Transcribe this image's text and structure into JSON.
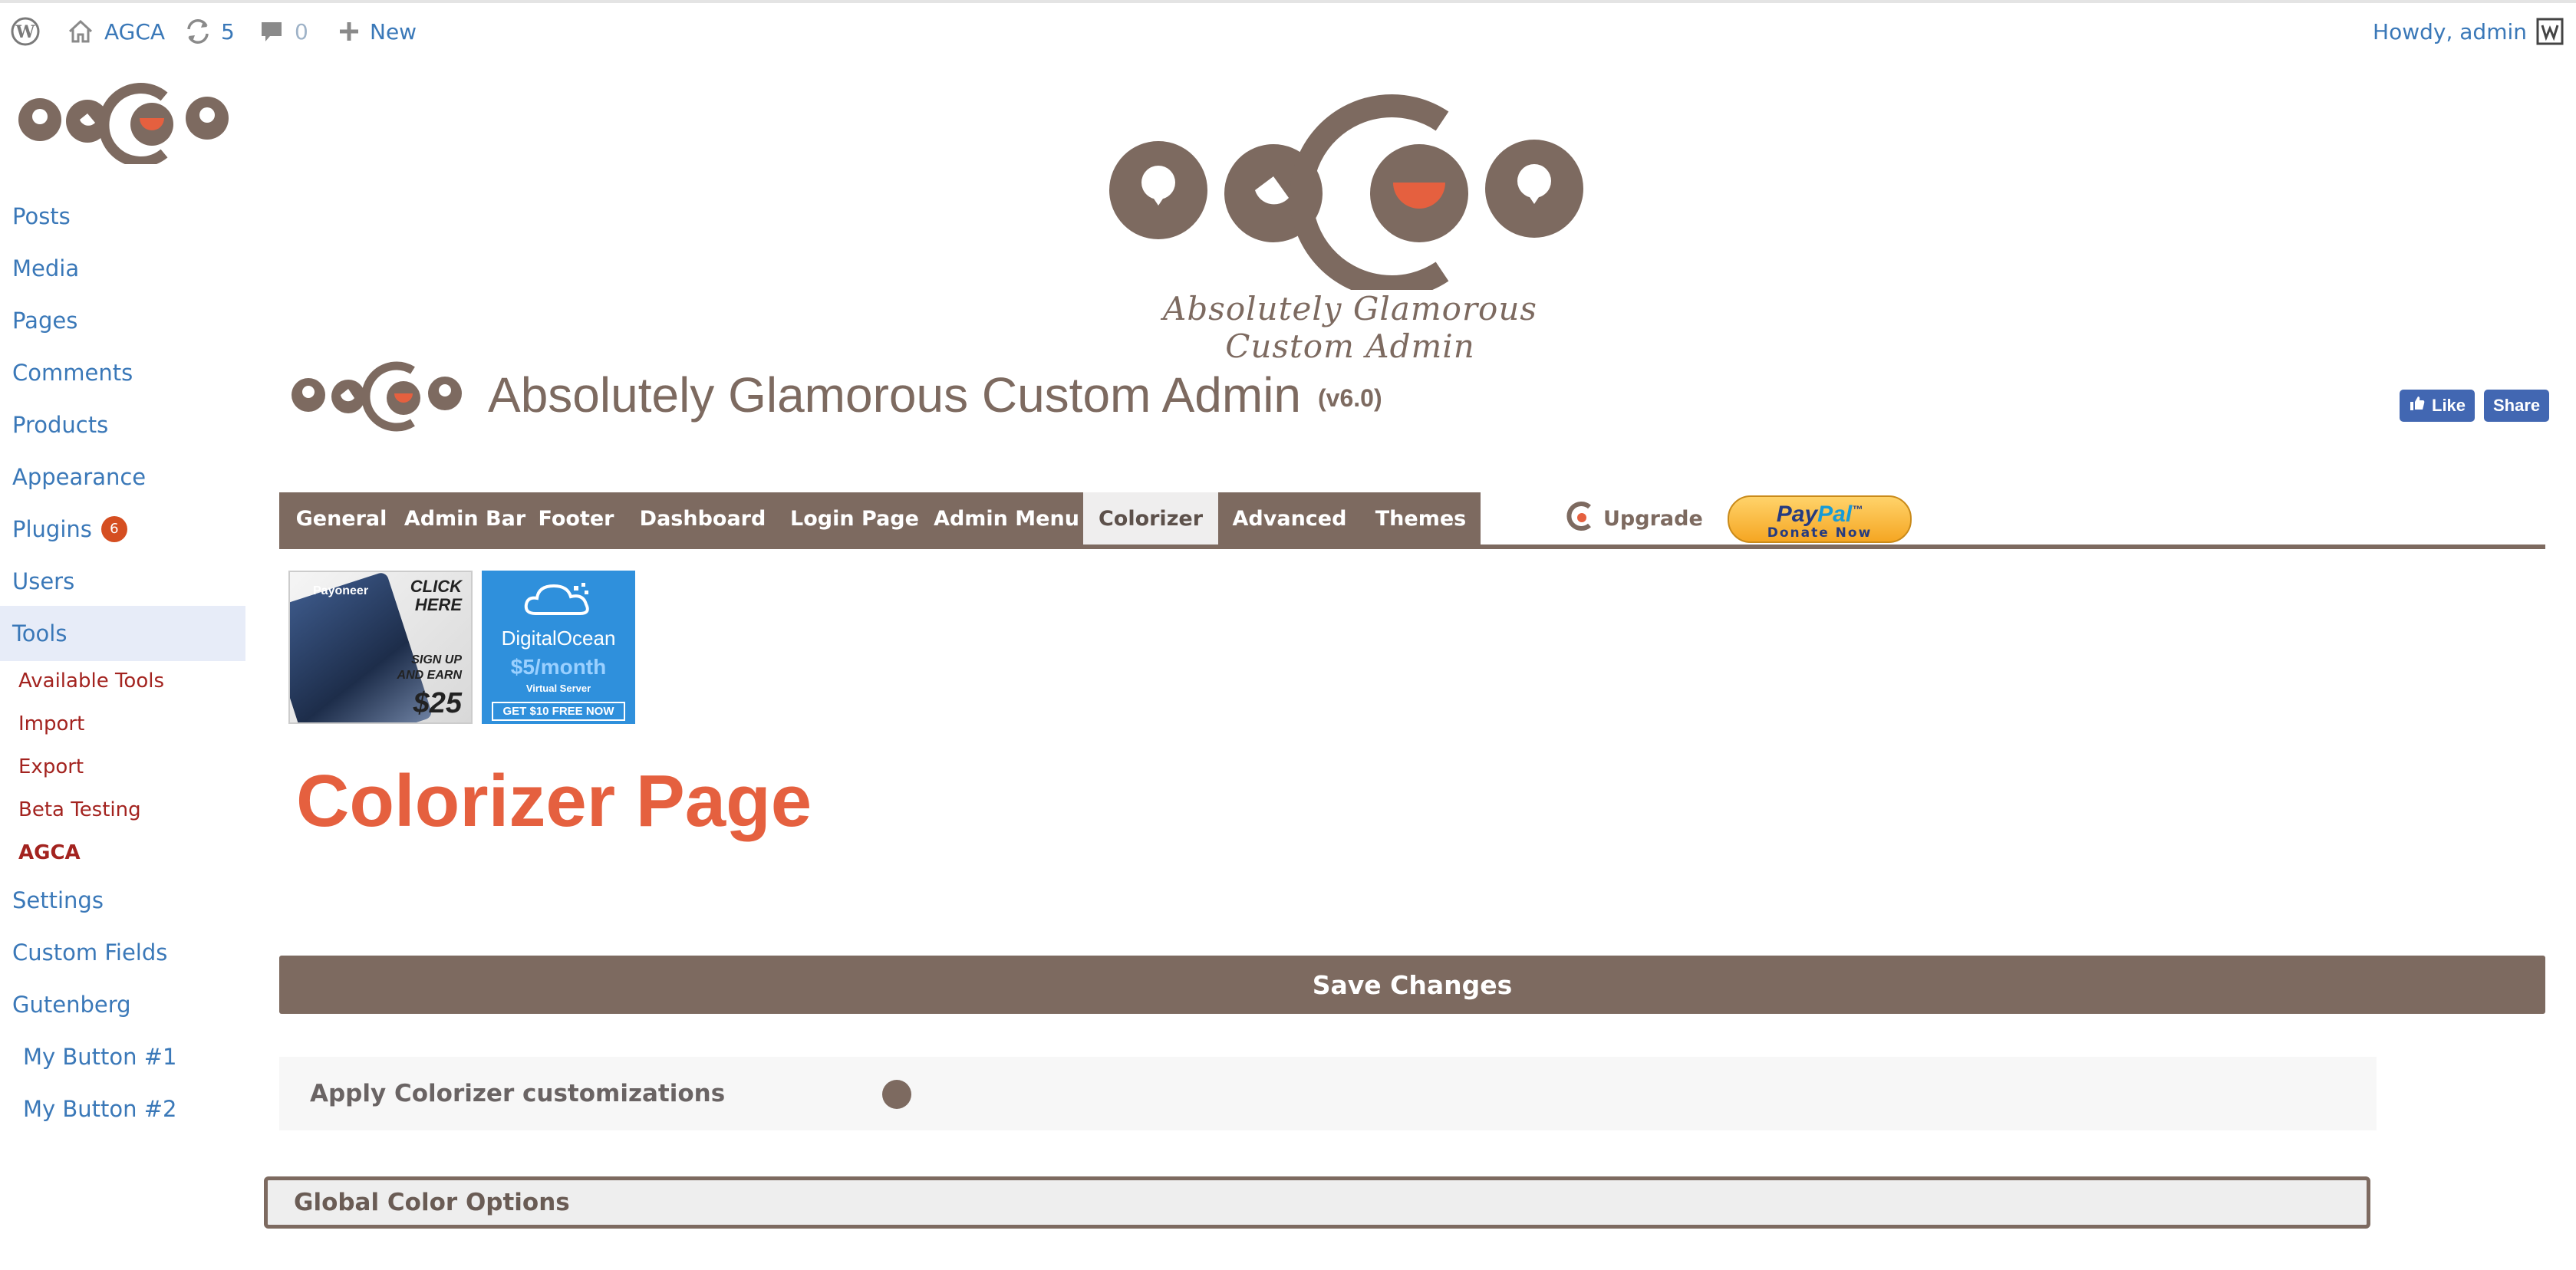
{
  "adminbar": {
    "site_name": "AGCA",
    "updates_count": "5",
    "comments_count": "0",
    "new_label": "New",
    "howdy": "Howdy, admin"
  },
  "sidebar": {
    "items": [
      {
        "label": "Posts"
      },
      {
        "label": "Media"
      },
      {
        "label": "Pages"
      },
      {
        "label": "Comments"
      },
      {
        "label": "Products"
      },
      {
        "label": "Appearance"
      },
      {
        "label": "Plugins",
        "badge": "6"
      },
      {
        "label": "Users"
      },
      {
        "label": "Tools"
      },
      {
        "label": "Settings"
      },
      {
        "label": "Custom Fields"
      },
      {
        "label": "Gutenberg"
      },
      {
        "label": "My Button #1"
      },
      {
        "label": "My Button #2"
      }
    ],
    "tools_submenu": [
      "Available Tools",
      "Import",
      "Export",
      "Beta Testing",
      "AGCA"
    ]
  },
  "header": {
    "tagline": "Absolutely Glamorous Custom Admin",
    "plugin_title": "Absolutely Glamorous Custom Admin",
    "version": "(v6.0)",
    "fb_like": "Like",
    "fb_share": "Share"
  },
  "tabs": {
    "items": [
      "General",
      "Admin Bar",
      "Footer",
      "Dashboard",
      "Login Page",
      "Admin Menu",
      "Colorizer",
      "Advanced",
      "Themes"
    ],
    "active": "Colorizer",
    "upgrade": "Upgrade",
    "paypal_logo_a": "Pay",
    "paypal_logo_b": "Pal",
    "paypal_tm": "™",
    "paypal_sub": "Donate Now"
  },
  "banners": {
    "payoneer": {
      "click": "CLICK",
      "here": "HERE",
      "signup": "SIGN UP",
      "earn": "AND EARN",
      "amount": "$25",
      "brand": "Payoneer"
    },
    "digitalocean": {
      "brand": "DigitalOcean",
      "price": "$5/month",
      "sub": "Virtual Server",
      "cta": "GET $10 FREE NOW"
    }
  },
  "page": {
    "heading": "Colorizer Page",
    "save_label": "Save Changes",
    "apply_label": "Apply Colorizer customizations",
    "global_label": "Global Color Options"
  },
  "colors": {
    "brand_brown": "#7d6a60",
    "brand_orange": "#e5603f",
    "link_blue": "#3a78b8",
    "submenu_red": "#a3231f"
  }
}
